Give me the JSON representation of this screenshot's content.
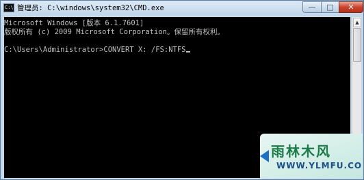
{
  "window": {
    "title": "管理员: C:\\windows\\system32\\CMD.exe",
    "icon": "cmd-icon",
    "buttons": {
      "minimize": "—",
      "maximize": "□",
      "close": "✕"
    }
  },
  "console": {
    "lines": [
      "Microsoft Windows [版本 6.1.7601]",
      "版权所有 (c) 2009 Microsoft Corporation。保留所有权利。",
      "",
      "C:\\Users\\Administrator>CONVERT X: /FS:NTFS"
    ],
    "text_color": "#c0c0c0",
    "background": "#000000"
  },
  "scrollbar": {
    "up": "▲",
    "down": "▼"
  },
  "watermark": {
    "logo": "雨林木风",
    "url": "WWW.YLMFU.COM"
  }
}
